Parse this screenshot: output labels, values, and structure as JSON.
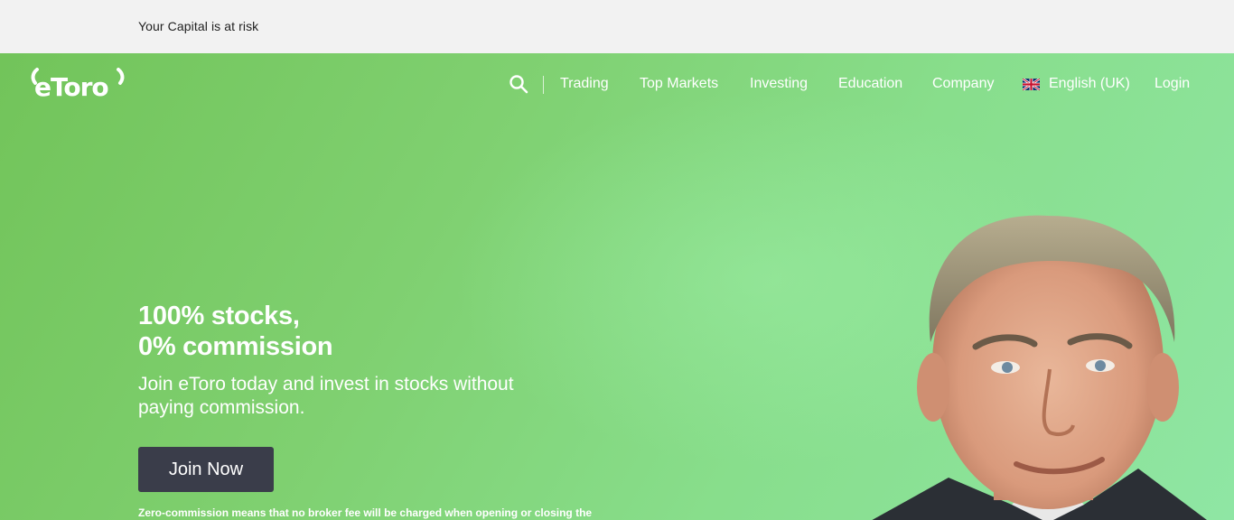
{
  "risk_banner": {
    "text": "Your Capital is at risk"
  },
  "logo": {
    "alt": "eToro"
  },
  "nav": {
    "search_icon": "search-icon",
    "items": [
      {
        "label": "Trading"
      },
      {
        "label": "Top Markets"
      },
      {
        "label": "Investing"
      },
      {
        "label": "Education"
      },
      {
        "label": "Company"
      },
      {
        "label": "English (UK)",
        "icon": "uk-flag-icon"
      },
      {
        "label": "Login"
      }
    ]
  },
  "hero": {
    "headline_line1": "100% stocks,",
    "headline_line2": "0% commission",
    "subline": "Join eToro today and invest in stocks without paying commission.",
    "cta_label": "Join Now",
    "disclaimer": "Zero-commission means that no broker fee will be charged when opening or closing the"
  },
  "colors": {
    "hero_green": "#7fd070",
    "button_dark": "#3a3d4a",
    "text_white": "#ffffff"
  }
}
